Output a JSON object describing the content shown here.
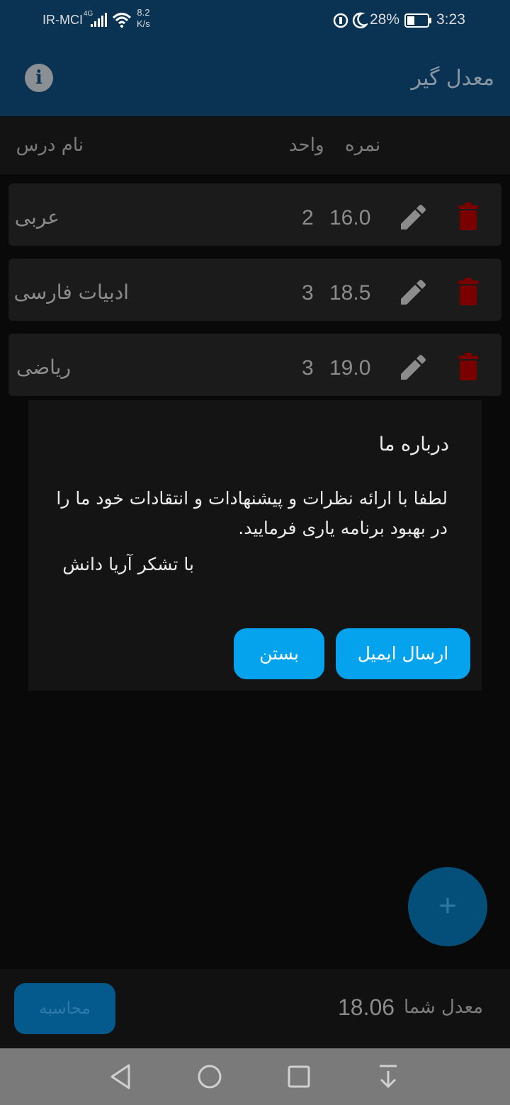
{
  "status_bar": {
    "carrier": "IR-MCI",
    "network": "4G",
    "speed_value": "8.2",
    "speed_unit": "K/s",
    "battery": "28%",
    "time": "3:23"
  },
  "app_bar": {
    "title": "معدل گیر",
    "info_icon": "info-icon"
  },
  "table_header": {
    "name_col": "نام درس",
    "grade_col": "نمره",
    "unit_col": "واحد"
  },
  "courses": [
    {
      "name": "عربی",
      "grade": "16.0",
      "unit": "2"
    },
    {
      "name": "ادبیات فارسی",
      "grade": "18.5",
      "unit": "3"
    },
    {
      "name": "ریاضی",
      "grade": "19.0",
      "unit": "3"
    }
  ],
  "dialog": {
    "title": "درباره ما",
    "body": "لطفا با ارائه نظرات و پیشنهادات و انتقادات خود ما را در بهبود برنامه یاری فرمایید.",
    "thanks": "با تشکر آریا دانش",
    "email_button": "ارسال ایمیل",
    "close_button": "بستن"
  },
  "fab": {
    "label": "+"
  },
  "bottom": {
    "calculate_button": "محاسبه",
    "average_label": "معدل شما",
    "average_value": "18.06"
  },
  "colors": {
    "app_bar": "#0a3252",
    "accent": "#05a3ed",
    "delete": "#7a0000",
    "edit": "#8c8c8c"
  }
}
